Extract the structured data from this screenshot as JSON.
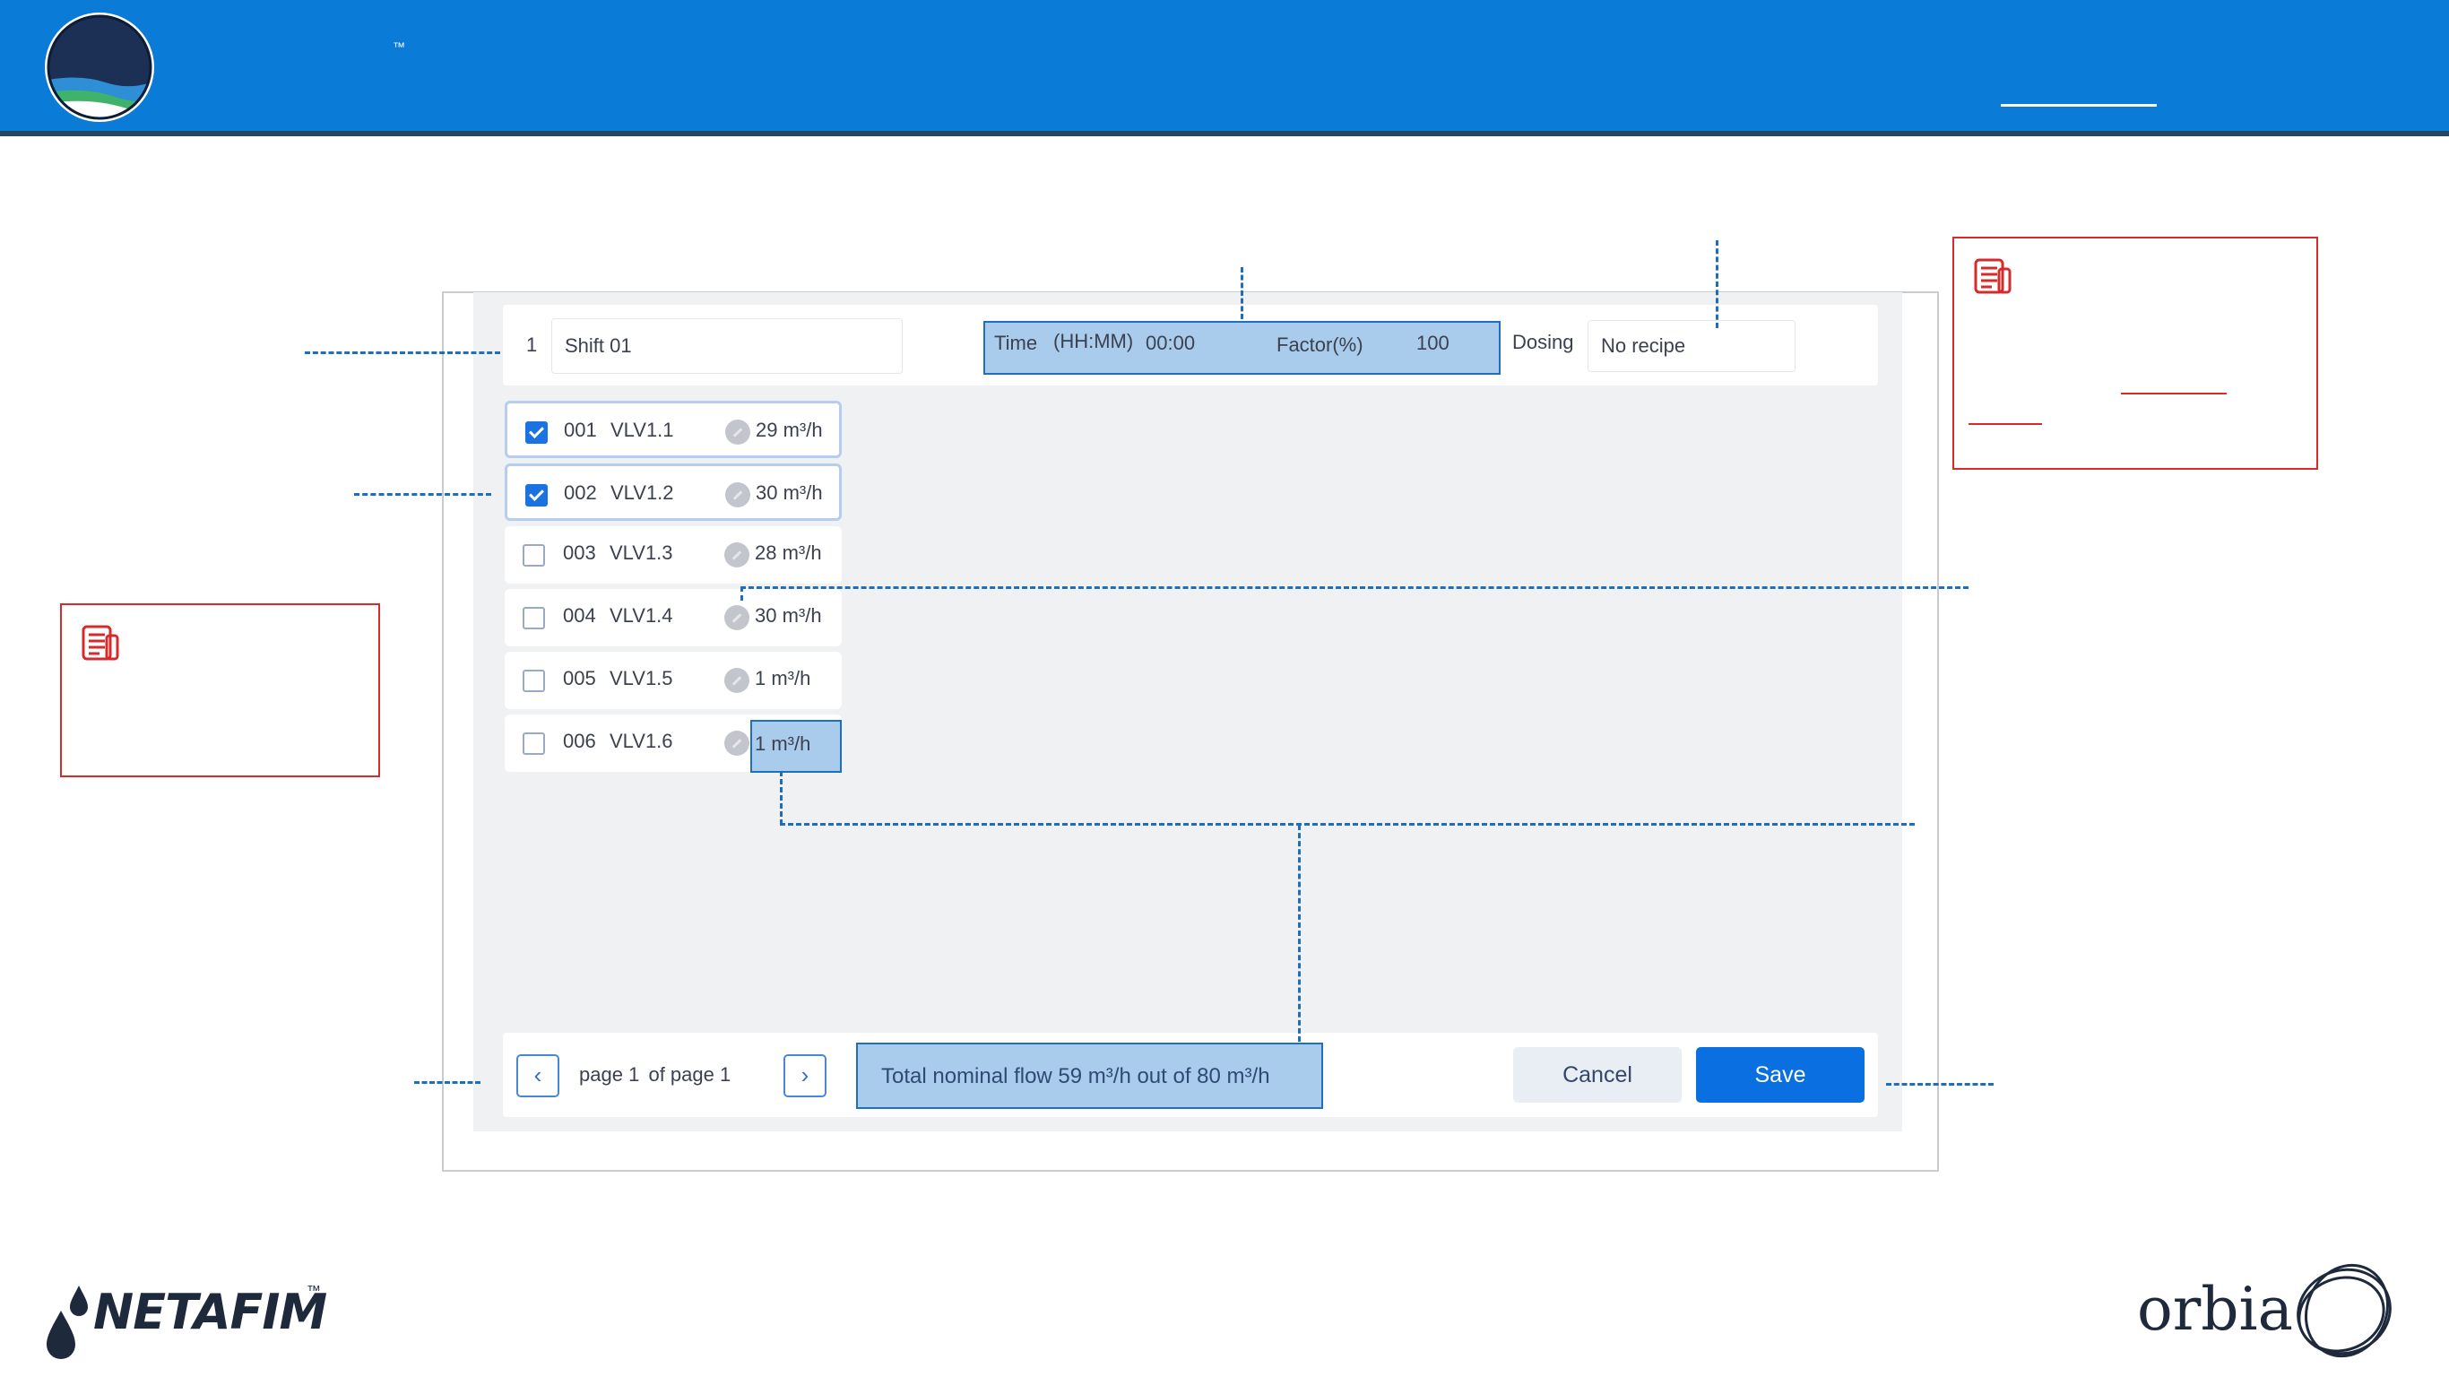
{
  "header": {
    "trademark": "™",
    "colors": {
      "bar": "#0a7bd6",
      "edge": "#24465f"
    }
  },
  "shift": {
    "number": "1",
    "name": "Shift 01",
    "time_label": "Time",
    "time_format": "(HH:MM)",
    "time_value": "00:00",
    "factor_label": "Factor(%)",
    "factor_value": "100",
    "dosing_label": "Dosing",
    "dosing_value": "No recipe"
  },
  "valves": [
    {
      "id": "001",
      "name": "VLV1.1",
      "flow": "29 m³/h",
      "checked": true
    },
    {
      "id": "002",
      "name": "VLV1.2",
      "flow": "30 m³/h",
      "checked": true
    },
    {
      "id": "003",
      "name": "VLV1.3",
      "flow": "28 m³/h",
      "checked": false
    },
    {
      "id": "004",
      "name": "VLV1.4",
      "flow": "30 m³/h",
      "checked": false
    },
    {
      "id": "005",
      "name": "VLV1.5",
      "flow": "1 m³/h",
      "checked": false
    },
    {
      "id": "006",
      "name": "VLV1.6",
      "flow": "1 m³/h",
      "checked": false
    }
  ],
  "pagination": {
    "prev": "‹",
    "next": "›",
    "page_word": "page",
    "current": "1",
    "of_text": "of page",
    "total": "1"
  },
  "total_flow": "Total nominal flow 59 m³/h out of 80 m³/h",
  "buttons": {
    "cancel": "Cancel",
    "save": "Save"
  },
  "footer": {
    "netafim": "NETAFIM",
    "netafim_tm": "™",
    "orbia": "orbia"
  },
  "accent_colors": {
    "highlight": "#a9cbec",
    "callout": "#1f6fb8",
    "note_border": "#d62b2b",
    "save": "#0a6fe0"
  }
}
